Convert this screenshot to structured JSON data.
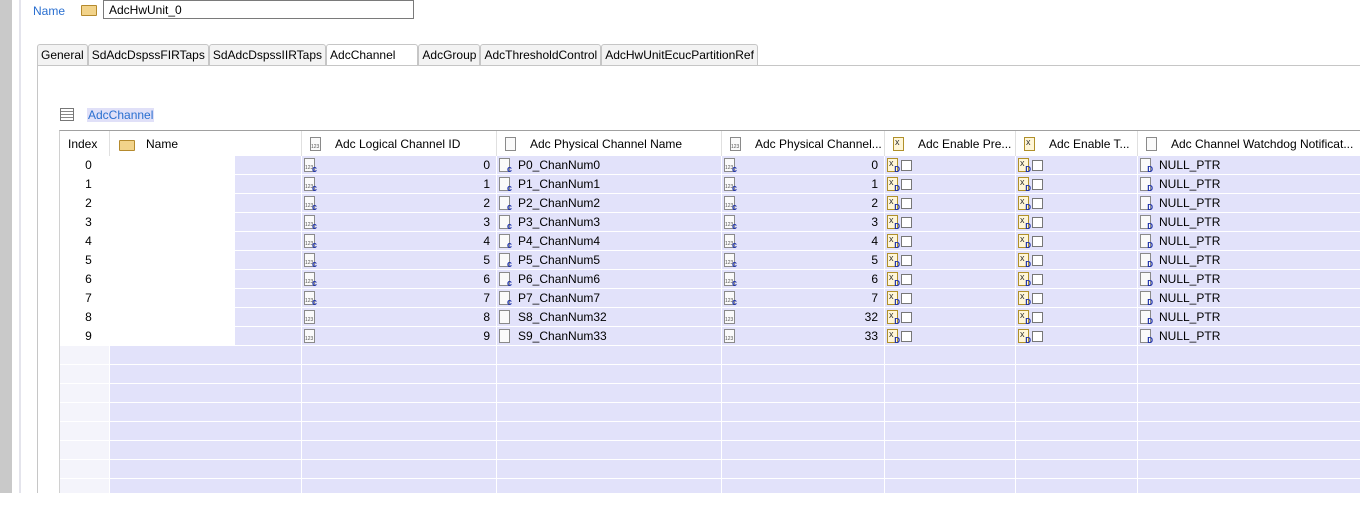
{
  "header": {
    "name_label": "Name",
    "name_value": "AdcHwUnit_0"
  },
  "tabs": [
    "General",
    "SdAdcDspssFIRTaps",
    "SdAdcDspssIIRTaps",
    "AdcChannel",
    "AdcGroup",
    "AdcThresholdControl",
    "AdcHwUnitEcucPartitionRef"
  ],
  "active_tab": "AdcChannel",
  "section_title": "AdcChannel",
  "columns": [
    "Index",
    "Name",
    "Adc Logical Channel ID",
    "Adc Physical Channel Name",
    "Adc Physical Channel...",
    "Adc Enable Pre...",
    "Adc Enable T...",
    "Adc Channel Watchdog Notificat..."
  ],
  "rows": [
    {
      "index": "0",
      "name": "",
      "logical_id": "0",
      "phys_name": "P0_ChanNum0",
      "phys_id": "0",
      "enable_pre": false,
      "enable_t": false,
      "watchdog": "NULL_PTR",
      "derived": true
    },
    {
      "index": "1",
      "name": "",
      "logical_id": "1",
      "phys_name": "P1_ChanNum1",
      "phys_id": "1",
      "enable_pre": false,
      "enable_t": false,
      "watchdog": "NULL_PTR",
      "derived": true
    },
    {
      "index": "2",
      "name": "",
      "logical_id": "2",
      "phys_name": "P2_ChanNum2",
      "phys_id": "2",
      "enable_pre": false,
      "enable_t": false,
      "watchdog": "NULL_PTR",
      "derived": true
    },
    {
      "index": "3",
      "name": "",
      "logical_id": "3",
      "phys_name": "P3_ChanNum3",
      "phys_id": "3",
      "enable_pre": false,
      "enable_t": false,
      "watchdog": "NULL_PTR",
      "derived": true
    },
    {
      "index": "4",
      "name": "",
      "logical_id": "4",
      "phys_name": "P4_ChanNum4",
      "phys_id": "4",
      "enable_pre": false,
      "enable_t": false,
      "watchdog": "NULL_PTR",
      "derived": true
    },
    {
      "index": "5",
      "name": "",
      "logical_id": "5",
      "phys_name": "P5_ChanNum5",
      "phys_id": "5",
      "enable_pre": false,
      "enable_t": false,
      "watchdog": "NULL_PTR",
      "derived": true
    },
    {
      "index": "6",
      "name": "",
      "logical_id": "6",
      "phys_name": "P6_ChanNum6",
      "phys_id": "6",
      "enable_pre": false,
      "enable_t": false,
      "watchdog": "NULL_PTR",
      "derived": true
    },
    {
      "index": "7",
      "name": "",
      "logical_id": "7",
      "phys_name": "P7_ChanNum7",
      "phys_id": "7",
      "enable_pre": false,
      "enable_t": false,
      "watchdog": "NULL_PTR",
      "derived": true
    },
    {
      "index": "8",
      "name": "",
      "logical_id": "8",
      "phys_name": "S8_ChanNum32",
      "phys_id": "32",
      "enable_pre": false,
      "enable_t": false,
      "watchdog": "NULL_PTR",
      "derived": false
    },
    {
      "index": "9",
      "name": "",
      "logical_id": "9",
      "phys_name": "S9_ChanNum33",
      "phys_id": "33",
      "enable_pre": false,
      "enable_t": false,
      "watchdog": "NULL_PTR",
      "derived": false
    }
  ],
  "colors": {
    "selection": "#e2e2fa",
    "link": "#2a6fd0"
  }
}
